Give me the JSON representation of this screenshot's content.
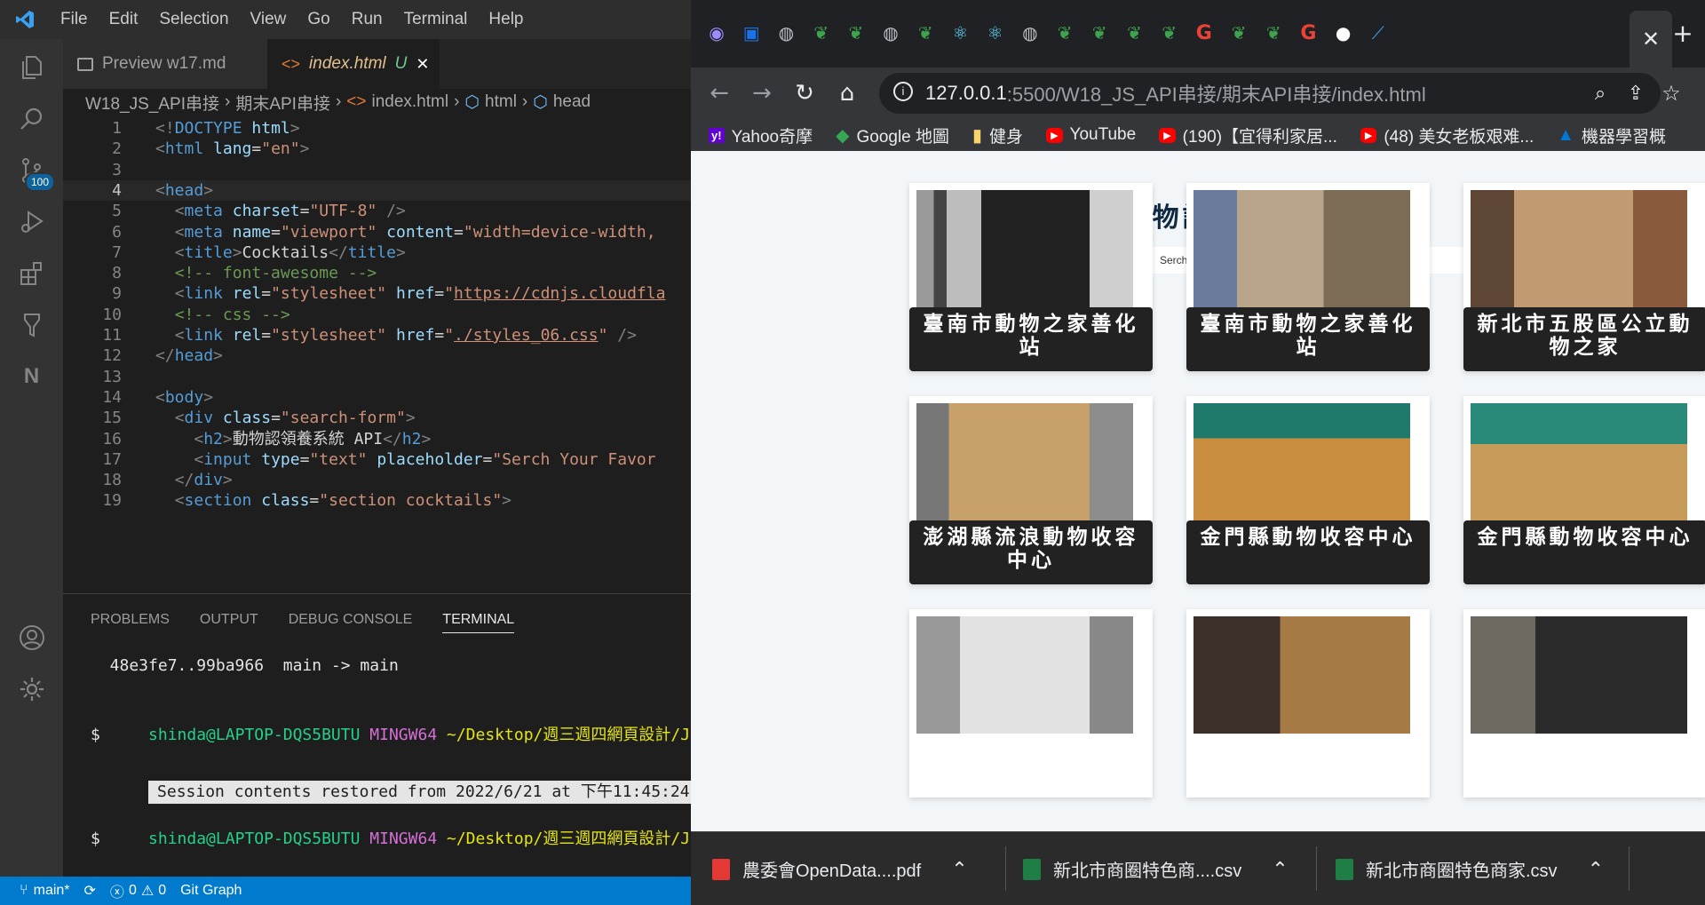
{
  "vscode": {
    "menu": [
      "File",
      "Edit",
      "Selection",
      "View",
      "Go",
      "Run",
      "Terminal",
      "Help"
    ],
    "scm_badge": "100",
    "tabs": [
      {
        "label": "Preview w17.md"
      },
      {
        "label": "index.html",
        "status": "U"
      }
    ],
    "breadcrumb": [
      "W18_JS_API串接",
      "期末API串接",
      "index.html",
      "html",
      "head"
    ],
    "code_lines": [
      {
        "n": "1",
        "tokens": [
          [
            "p",
            "<!"
          ],
          [
            "t",
            "DOCTYPE"
          ],
          [
            "x",
            " "
          ],
          [
            "a",
            "html"
          ],
          [
            "p",
            ">"
          ]
        ]
      },
      {
        "n": "2",
        "tokens": [
          [
            "p",
            "<"
          ],
          [
            "t",
            "html"
          ],
          [
            "x",
            " "
          ],
          [
            "a",
            "lang"
          ],
          [
            "x",
            "="
          ],
          [
            "s",
            "\"en\""
          ],
          [
            "p",
            ">"
          ]
        ]
      },
      {
        "n": "3",
        "tokens": []
      },
      {
        "n": "4",
        "tokens": [
          [
            "p",
            "<"
          ],
          [
            "t",
            "head"
          ],
          [
            "p",
            ">"
          ]
        ]
      },
      {
        "n": "5",
        "tokens": [
          [
            "x",
            "  "
          ],
          [
            "p",
            "<"
          ],
          [
            "t",
            "meta"
          ],
          [
            "x",
            " "
          ],
          [
            "a",
            "charset"
          ],
          [
            "x",
            "="
          ],
          [
            "s",
            "\"UTF-8\""
          ],
          [
            "x",
            " "
          ],
          [
            "p",
            "/>"
          ]
        ]
      },
      {
        "n": "6",
        "tokens": [
          [
            "x",
            "  "
          ],
          [
            "p",
            "<"
          ],
          [
            "t",
            "meta"
          ],
          [
            "x",
            " "
          ],
          [
            "a",
            "name"
          ],
          [
            "x",
            "="
          ],
          [
            "s",
            "\"viewport\""
          ],
          [
            "x",
            " "
          ],
          [
            "a",
            "content"
          ],
          [
            "x",
            "="
          ],
          [
            "s",
            "\"width=device-width,"
          ]
        ]
      },
      {
        "n": "7",
        "tokens": [
          [
            "x",
            "  "
          ],
          [
            "p",
            "<"
          ],
          [
            "t",
            "title"
          ],
          [
            "p",
            ">"
          ],
          [
            "x",
            "Cocktails"
          ],
          [
            "p",
            "</"
          ],
          [
            "t",
            "title"
          ],
          [
            "p",
            ">"
          ]
        ]
      },
      {
        "n": "8",
        "tokens": [
          [
            "x",
            "  "
          ],
          [
            "c",
            "<!-- font-awesome -->"
          ]
        ]
      },
      {
        "n": "9",
        "tokens": [
          [
            "x",
            "  "
          ],
          [
            "p",
            "<"
          ],
          [
            "t",
            "link"
          ],
          [
            "x",
            " "
          ],
          [
            "a",
            "rel"
          ],
          [
            "x",
            "="
          ],
          [
            "s",
            "\"stylesheet\""
          ],
          [
            "x",
            " "
          ],
          [
            "a",
            "href"
          ],
          [
            "x",
            "="
          ],
          [
            "s",
            "\""
          ],
          [
            "u",
            "https://cdnjs.cloudfla"
          ]
        ]
      },
      {
        "n": "10",
        "tokens": [
          [
            "x",
            "  "
          ],
          [
            "c",
            "<!-- css -->"
          ]
        ]
      },
      {
        "n": "11",
        "tokens": [
          [
            "x",
            "  "
          ],
          [
            "p",
            "<"
          ],
          [
            "t",
            "link"
          ],
          [
            "x",
            " "
          ],
          [
            "a",
            "rel"
          ],
          [
            "x",
            "="
          ],
          [
            "s",
            "\"stylesheet\""
          ],
          [
            "x",
            " "
          ],
          [
            "a",
            "href"
          ],
          [
            "x",
            "="
          ],
          [
            "s",
            "\""
          ],
          [
            "u",
            "./styles_06.css"
          ],
          [
            "s",
            "\""
          ],
          [
            "x",
            " "
          ],
          [
            "p",
            "/>"
          ]
        ]
      },
      {
        "n": "12",
        "tokens": [
          [
            "p",
            "</"
          ],
          [
            "t",
            "head"
          ],
          [
            "p",
            ">"
          ]
        ]
      },
      {
        "n": "13",
        "tokens": []
      },
      {
        "n": "14",
        "tokens": [
          [
            "p",
            "<"
          ],
          [
            "t",
            "body"
          ],
          [
            "p",
            ">"
          ]
        ]
      },
      {
        "n": "15",
        "tokens": [
          [
            "x",
            "  "
          ],
          [
            "p",
            "<"
          ],
          [
            "t",
            "div"
          ],
          [
            "x",
            " "
          ],
          [
            "a",
            "class"
          ],
          [
            "x",
            "="
          ],
          [
            "s",
            "\"search-form\""
          ],
          [
            "p",
            ">"
          ]
        ]
      },
      {
        "n": "16",
        "tokens": [
          [
            "x",
            "    "
          ],
          [
            "p",
            "<"
          ],
          [
            "t",
            "h2"
          ],
          [
            "p",
            ">"
          ],
          [
            "x",
            "動物認領養系統 API"
          ],
          [
            "p",
            "</"
          ],
          [
            "t",
            "h2"
          ],
          [
            "p",
            ">"
          ]
        ]
      },
      {
        "n": "17",
        "tokens": [
          [
            "x",
            "    "
          ],
          [
            "p",
            "<"
          ],
          [
            "t",
            "input"
          ],
          [
            "x",
            " "
          ],
          [
            "a",
            "type"
          ],
          [
            "x",
            "="
          ],
          [
            "s",
            "\"text\""
          ],
          [
            "x",
            " "
          ],
          [
            "a",
            "placeholder"
          ],
          [
            "x",
            "="
          ],
          [
            "s",
            "\"Serch Your Favor"
          ]
        ]
      },
      {
        "n": "18",
        "tokens": [
          [
            "x",
            "  "
          ],
          [
            "p",
            "</"
          ],
          [
            "t",
            "div"
          ],
          [
            "p",
            ">"
          ]
        ]
      },
      {
        "n": "19",
        "tokens": [
          [
            "x",
            "  "
          ],
          [
            "p",
            "<"
          ],
          [
            "t",
            "section"
          ],
          [
            "x",
            " "
          ],
          [
            "a",
            "class"
          ],
          [
            "x",
            "="
          ],
          [
            "s",
            "\"section cocktails\""
          ],
          [
            "p",
            ">"
          ]
        ]
      }
    ],
    "panel_tabs": [
      "PROBLEMS",
      "OUTPUT",
      "DEBUG CONSOLE",
      "TERMINAL"
    ],
    "terminal": {
      "line1": "  48e3fe7..99ba966  main -> main",
      "user": "shinda@LAPTOP-DQS5BUTU",
      "shell": "MINGW64",
      "path": "~/Desktop/週三週四網頁設計/JS-",
      "prompt": "$",
      "session": "Session contents restored from 2022/6/21 at 下午11:45:24"
    },
    "status": {
      "branch": "main*",
      "errors": "0",
      "warnings": "0",
      "git_graph": "Git Graph"
    }
  },
  "browser": {
    "url_host": "127.0.0.1",
    "url_path": ":5500/W18_JS_API串接/期末API串接/index.html",
    "bookmarks": [
      {
        "label": "Yahoo奇摩",
        "icon": "yahoo-icon"
      },
      {
        "label": "Google 地圖",
        "icon": "maps-icon"
      },
      {
        "label": "健身",
        "icon": "folder-icon"
      },
      {
        "label": "YouTube",
        "icon": "youtube-icon"
      },
      {
        "label": "(190)【宜得利家居...",
        "icon": "youtube-icon"
      },
      {
        "label": "(48) 美女老板艰难...",
        "icon": "youtube-icon"
      },
      {
        "label": "機器學習概",
        "icon": "azure-icon"
      }
    ],
    "page": {
      "title": "動物認領養系統 API",
      "search_placeholder": "Serch Your Favorite Cocktail",
      "cards": [
        {
          "label": "臺南市動物之家善化站"
        },
        {
          "label": "臺南市動物之家善化站"
        },
        {
          "label": "新北市五股區公立動物之家"
        },
        {
          "label": "澎湖縣流浪動物收容中心"
        },
        {
          "label": "金門縣動物收容中心"
        },
        {
          "label": "金門縣動物收容中心"
        },
        {
          "label": ""
        },
        {
          "label": ""
        },
        {
          "label": ""
        }
      ]
    },
    "downloads": [
      {
        "label": "農委會OpenData....pdf",
        "icon": "pdf-icon"
      },
      {
        "label": "新北市商圈特色商....csv",
        "icon": "excel-icon"
      },
      {
        "label": "新北市商圈特色商家.csv",
        "icon": "excel-icon"
      }
    ]
  },
  "colors": {
    "accent": "#007acc",
    "card_label_bg": "#222222",
    "page_bg": "#f3f6f9"
  }
}
